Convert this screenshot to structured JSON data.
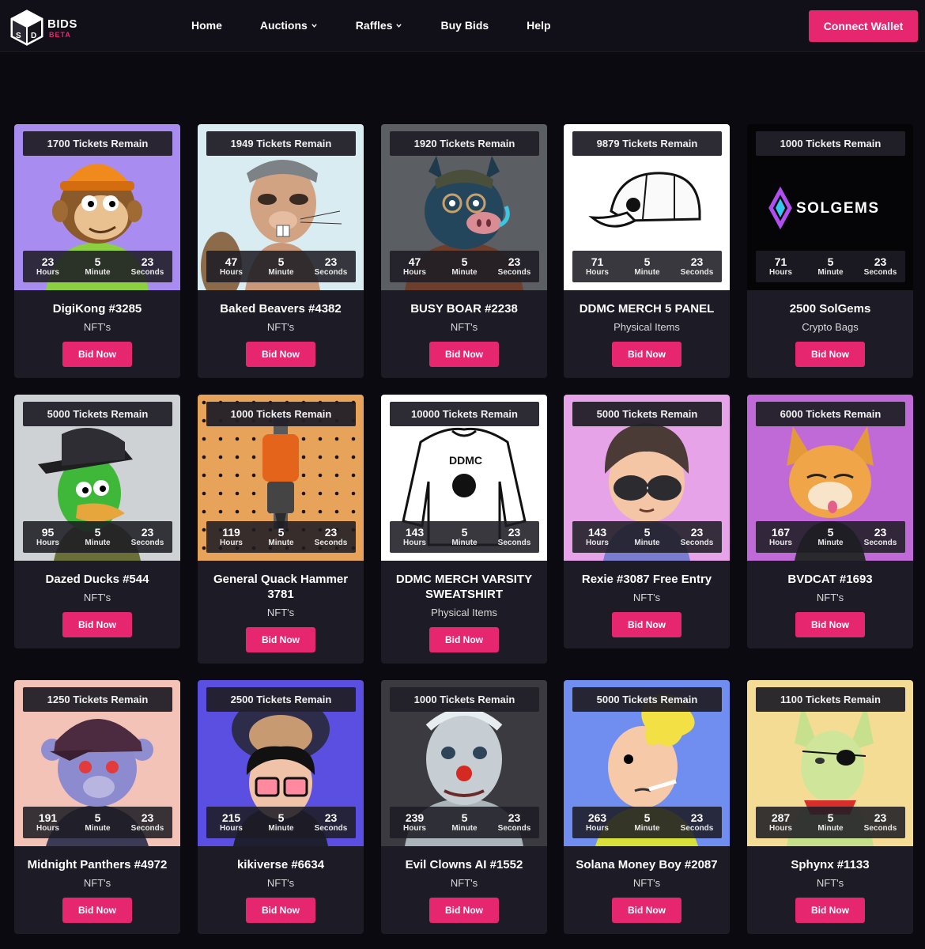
{
  "brand": {
    "name": "BIDS",
    "tag": "BETA"
  },
  "nav": {
    "items": [
      {
        "label": "Home",
        "dropdown": false
      },
      {
        "label": "Auctions",
        "dropdown": true
      },
      {
        "label": "Raffles",
        "dropdown": true
      },
      {
        "label": "Buy Bids",
        "dropdown": false
      },
      {
        "label": "Help",
        "dropdown": false
      }
    ],
    "connect_label": "Connect Wallet"
  },
  "timer_labels": {
    "hours": "Hours",
    "minute": "Minute",
    "seconds": "Seconds"
  },
  "bid_label": "Bid Now",
  "colors": {
    "accent": "#e6266f",
    "page_bg": "#0b0a10",
    "card_bg": "#1c1b26"
  },
  "raffles": [
    {
      "tickets": "1700 Tickets Remain",
      "hours": "23",
      "minutes": "5",
      "seconds": "23",
      "title": "DigiKong #3285",
      "category": "NFT's",
      "art": "monkey"
    },
    {
      "tickets": "1949 Tickets Remain",
      "hours": "47",
      "minutes": "5",
      "seconds": "23",
      "title": "Baked Beavers #4382",
      "category": "NFT's",
      "art": "beaver"
    },
    {
      "tickets": "1920 Tickets Remain",
      "hours": "47",
      "minutes": "5",
      "seconds": "23",
      "title": "BUSY BOAR #2238",
      "category": "NFT's",
      "art": "boar"
    },
    {
      "tickets": "9879 Tickets Remain",
      "hours": "71",
      "minutes": "5",
      "seconds": "23",
      "title": "DDMC MERCH 5 PANEL",
      "category": "Physical Items",
      "art": "cap"
    },
    {
      "tickets": "1000 Tickets Remain",
      "hours": "71",
      "minutes": "5",
      "seconds": "23",
      "title": "2500 SolGems",
      "category": "Crypto Bags",
      "art": "solgems",
      "art_text": "SOLGEMS"
    },
    {
      "tickets": "5000 Tickets Remain",
      "hours": "95",
      "minutes": "5",
      "seconds": "23",
      "title": "Dazed Ducks #544",
      "category": "NFT's",
      "art": "duck"
    },
    {
      "tickets": "1000 Tickets Remain",
      "hours": "119",
      "minutes": "5",
      "seconds": "23",
      "title": "General Quack Hammer 3781",
      "category": "NFT's",
      "art": "hammer"
    },
    {
      "tickets": "10000 Tickets Remain",
      "hours": "143",
      "minutes": "5",
      "seconds": "23",
      "title": "DDMC MERCH VARSITY SWEATSHIRT",
      "category": "Physical Items",
      "art": "sweatshirt"
    },
    {
      "tickets": "5000 Tickets Remain",
      "hours": "143",
      "minutes": "5",
      "seconds": "23",
      "title": "Rexie #3087 Free Entry",
      "category": "NFT's",
      "art": "rexie"
    },
    {
      "tickets": "6000 Tickets Remain",
      "hours": "167",
      "minutes": "5",
      "seconds": "23",
      "title": "BVDCAT #1693",
      "category": "NFT's",
      "art": "cat"
    },
    {
      "tickets": "1250 Tickets Remain",
      "hours": "191",
      "minutes": "5",
      "seconds": "23",
      "title": "Midnight Panthers #4972",
      "category": "NFT's",
      "art": "panther"
    },
    {
      "tickets": "2500 Tickets Remain",
      "hours": "215",
      "minutes": "5",
      "seconds": "23",
      "title": "kikiverse #6634",
      "category": "NFT's",
      "art": "kiki"
    },
    {
      "tickets": "1000 Tickets Remain",
      "hours": "239",
      "minutes": "5",
      "seconds": "23",
      "title": "Evil Clowns AI #1552",
      "category": "NFT's",
      "art": "clown"
    },
    {
      "tickets": "5000 Tickets Remain",
      "hours": "263",
      "minutes": "5",
      "seconds": "23",
      "title": "Solana Money Boy #2087",
      "category": "NFT's",
      "art": "moneyboy"
    },
    {
      "tickets": "1100 Tickets Remain",
      "hours": "287",
      "minutes": "5",
      "seconds": "23",
      "title": "Sphynx #1133",
      "category": "NFT's",
      "art": "sphynx"
    }
  ]
}
